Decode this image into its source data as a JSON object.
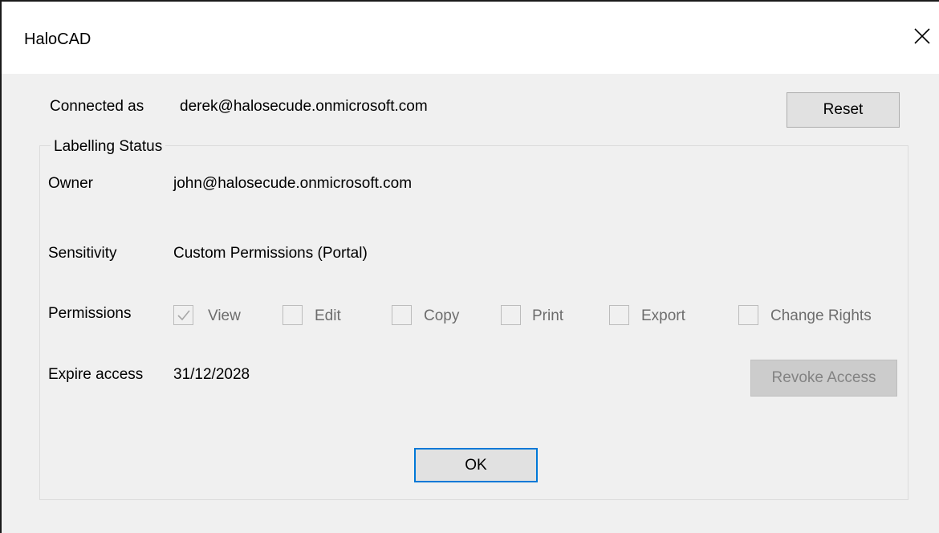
{
  "window": {
    "title": "HaloCAD"
  },
  "account": {
    "connected_label": "Connected as",
    "connected_value": "derek@halosecude.onmicrosoft.com",
    "reset_label": "Reset"
  },
  "labelling": {
    "group_title": "Labelling Status",
    "owner_label": "Owner",
    "owner_value": "john@halosecude.onmicrosoft.com",
    "sensitivity_label": "Sensitivity",
    "sensitivity_value": "Custom Permissions (Portal)",
    "permissions_label": "Permissions",
    "permissions": [
      {
        "label": "View",
        "checked": true
      },
      {
        "label": "Edit",
        "checked": false
      },
      {
        "label": "Copy",
        "checked": false
      },
      {
        "label": "Print",
        "checked": false
      },
      {
        "label": "Export",
        "checked": false
      },
      {
        "label": "Change Rights",
        "checked": false
      }
    ],
    "expire_label": "Expire access",
    "expire_value": "31/12/2028",
    "revoke_label": "Revoke Access"
  },
  "footer": {
    "ok_label": "OK"
  },
  "colors": {
    "dialog_bg": "#f0f0f0",
    "focus_border": "#0078d7",
    "disabled_text": "#838383"
  }
}
